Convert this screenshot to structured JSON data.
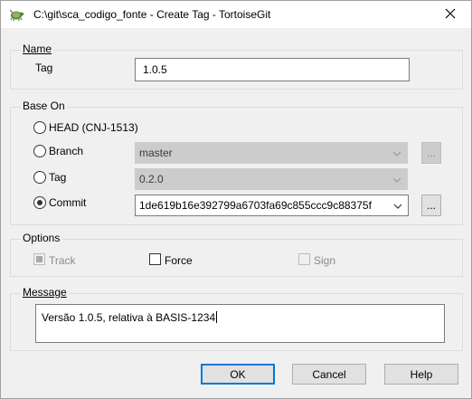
{
  "title_bar": {
    "title": "C:\\git\\sca_codigo_fonte - Create Tag - TortoiseGit",
    "app_icon": "tortoisegit-icon",
    "close_icon": "close-icon"
  },
  "name_group": {
    "label": "Name",
    "tag_label": "Tag",
    "tag_value": "1.0.5"
  },
  "base_on": {
    "label": "Base On",
    "head_label": "HEAD (CNJ-1513)",
    "branch_label": "Branch",
    "branch_value": "master",
    "tag_label": "Tag",
    "tag_value": "0.2.0",
    "commit_label": "Commit",
    "commit_value": "1de619b16e392799a6703fa69c855ccc9c88375f",
    "browse_label": "...",
    "selected": "Commit"
  },
  "options": {
    "label": "Options",
    "track_label": "Track",
    "force_label": "Force",
    "sign_label": "Sign",
    "track_checked": "indeterminate",
    "force_checked": false,
    "sign_checked": false
  },
  "message": {
    "label": "Message",
    "value": "Versão 1.0.5, relativa à BASIS-1234"
  },
  "buttons": {
    "ok": "OK",
    "cancel": "Cancel",
    "help": "Help"
  },
  "colors": {
    "default_button_border": "#0078d7",
    "window_bg": "#f0f0f0"
  }
}
